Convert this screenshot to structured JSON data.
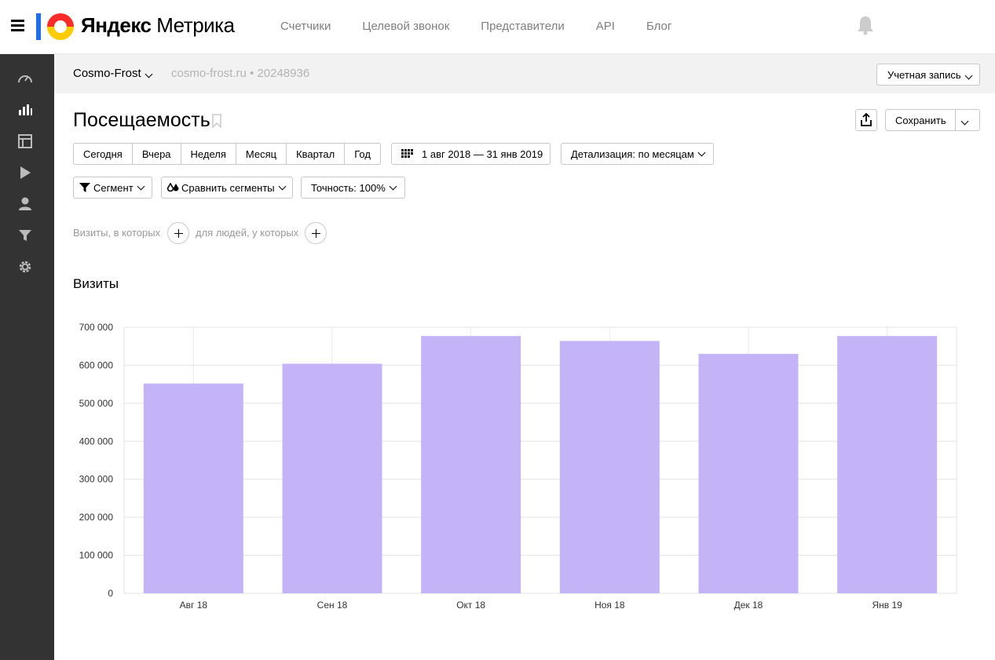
{
  "header": {
    "logo_text_bold": "Яндекс",
    "logo_text_rest": "Метрика",
    "nav": [
      "Счетчики",
      "Целевой звонок",
      "Представители",
      "API",
      "Блог"
    ]
  },
  "counter": {
    "name": "Cosmo-Frost",
    "site": "cosmo-frost.ru",
    "separator": "•",
    "id": "20248936",
    "account_label": "Учетная запись"
  },
  "report": {
    "title": "Посещаемость",
    "save_label": "Сохранить",
    "periods": [
      "Сегодня",
      "Вчера",
      "Неделя",
      "Месяц",
      "Квартал",
      "Год"
    ],
    "date_range": "1 авг 2018 — 31 янв 2019",
    "detail_label": "Детализация: по месяцам",
    "segment_label": "Сегмент",
    "compare_label": "Сравнить сегменты",
    "accuracy_label": "Точность: 100%",
    "visits_hint": "Визиты, в которых",
    "people_hint": "для людей, у которых",
    "chart_title": "Визиты"
  },
  "chart_data": {
    "type": "bar",
    "title": "Визиты",
    "categories": [
      "Авг 18",
      "Сен 18",
      "Окт 18",
      "Ноя 18",
      "Дек 18",
      "Янв 19"
    ],
    "values": [
      552000,
      604000,
      677000,
      664000,
      630000,
      677000
    ],
    "ylim": [
      0,
      700000
    ],
    "yticks": [
      0,
      100000,
      200000,
      300000,
      400000,
      500000,
      600000,
      700000
    ],
    "ytick_labels": [
      "0",
      "100 000",
      "200 000",
      "300 000",
      "400 000",
      "500 000",
      "600 000",
      "700 000"
    ],
    "grid": true,
    "bar_color": "#c4b3f7"
  },
  "colors": {
    "sidebar": "#333333",
    "logo_red": "#ff2b2b",
    "logo_yellow": "#ffcc00",
    "logo_blue": "#1e6ee8"
  }
}
